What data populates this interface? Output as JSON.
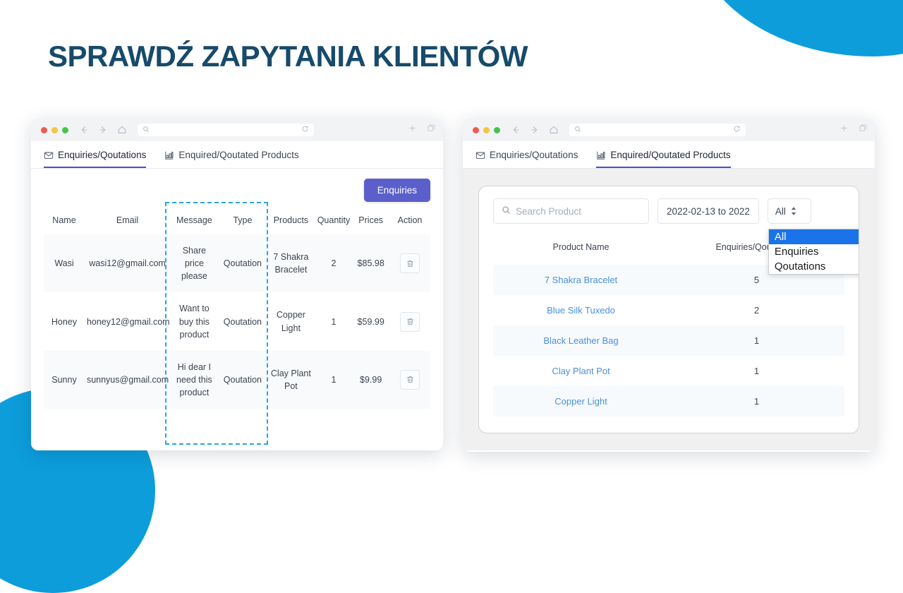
{
  "page": {
    "headline": "SPRAWDŹ ZAPYTANIA KLIENTÓW",
    "accent_blue": "#0d9ddb",
    "headline_color": "#174A6B",
    "button_color": "#5a5fcb",
    "link_color": "#4a90d9",
    "dashed_highlight_color": "#2aa3e8",
    "dropdown_highlight_color": "#1a73e8"
  },
  "left_window": {
    "tabs": [
      {
        "label": "Enquiries/Qoutations",
        "icon": "envelope-icon",
        "active": true
      },
      {
        "label": "Enquired/Qoutated Products",
        "icon": "bar-chart-icon",
        "active": false
      }
    ],
    "enquiries_button": "Enquiries",
    "table": {
      "columns": [
        "Name",
        "Email",
        "Message",
        "Type",
        "Products",
        "Quantity",
        "Prices",
        "Action"
      ],
      "rows": [
        {
          "name": "Wasi",
          "email": "wasi12@gmail.com",
          "message": "Share price please",
          "type": "Qoutation",
          "product": "7 Shakra Bracelet",
          "quantity": "2",
          "price": "$85.98",
          "action_icon": "trash-icon"
        },
        {
          "name": "Honey",
          "email": "honey12@gmail.com",
          "message": "Want to buy this product",
          "type": "Qoutation",
          "product": "Copper Light",
          "quantity": "1",
          "price": "$59.99",
          "action_icon": "trash-icon"
        },
        {
          "name": "Sunny",
          "email": "sunnyus@gmail.com",
          "message": "Hi dear I need this product",
          "type": "Qoutation",
          "product": "Clay Plant Pot",
          "quantity": "1",
          "price": "$9.99",
          "action_icon": "trash-icon"
        }
      ]
    }
  },
  "right_window": {
    "tabs": [
      {
        "label": "Enquiries/Qoutations",
        "icon": "envelope-icon",
        "active": false
      },
      {
        "label": "Enquired/Qoutated Products",
        "icon": "bar-chart-icon",
        "active": true
      }
    ],
    "filters": {
      "search_placeholder": "Search Product",
      "search_value": "",
      "date_range": "2022-02-13 to 2022",
      "select_value": "All",
      "select_options": [
        "All",
        "Enquiries",
        "Qoutations"
      ],
      "selected_option": "All"
    },
    "table": {
      "columns": [
        "Product Name",
        "Enquiries/Qoutations"
      ],
      "rows": [
        {
          "product": "7 Shakra Bracelet",
          "count": "5"
        },
        {
          "product": "Blue Silk Tuxedo",
          "count": "2"
        },
        {
          "product": "Black Leather Bag",
          "count": "1"
        },
        {
          "product": "Clay Plant Pot",
          "count": "1"
        },
        {
          "product": "Copper Light",
          "count": "1"
        }
      ]
    }
  }
}
